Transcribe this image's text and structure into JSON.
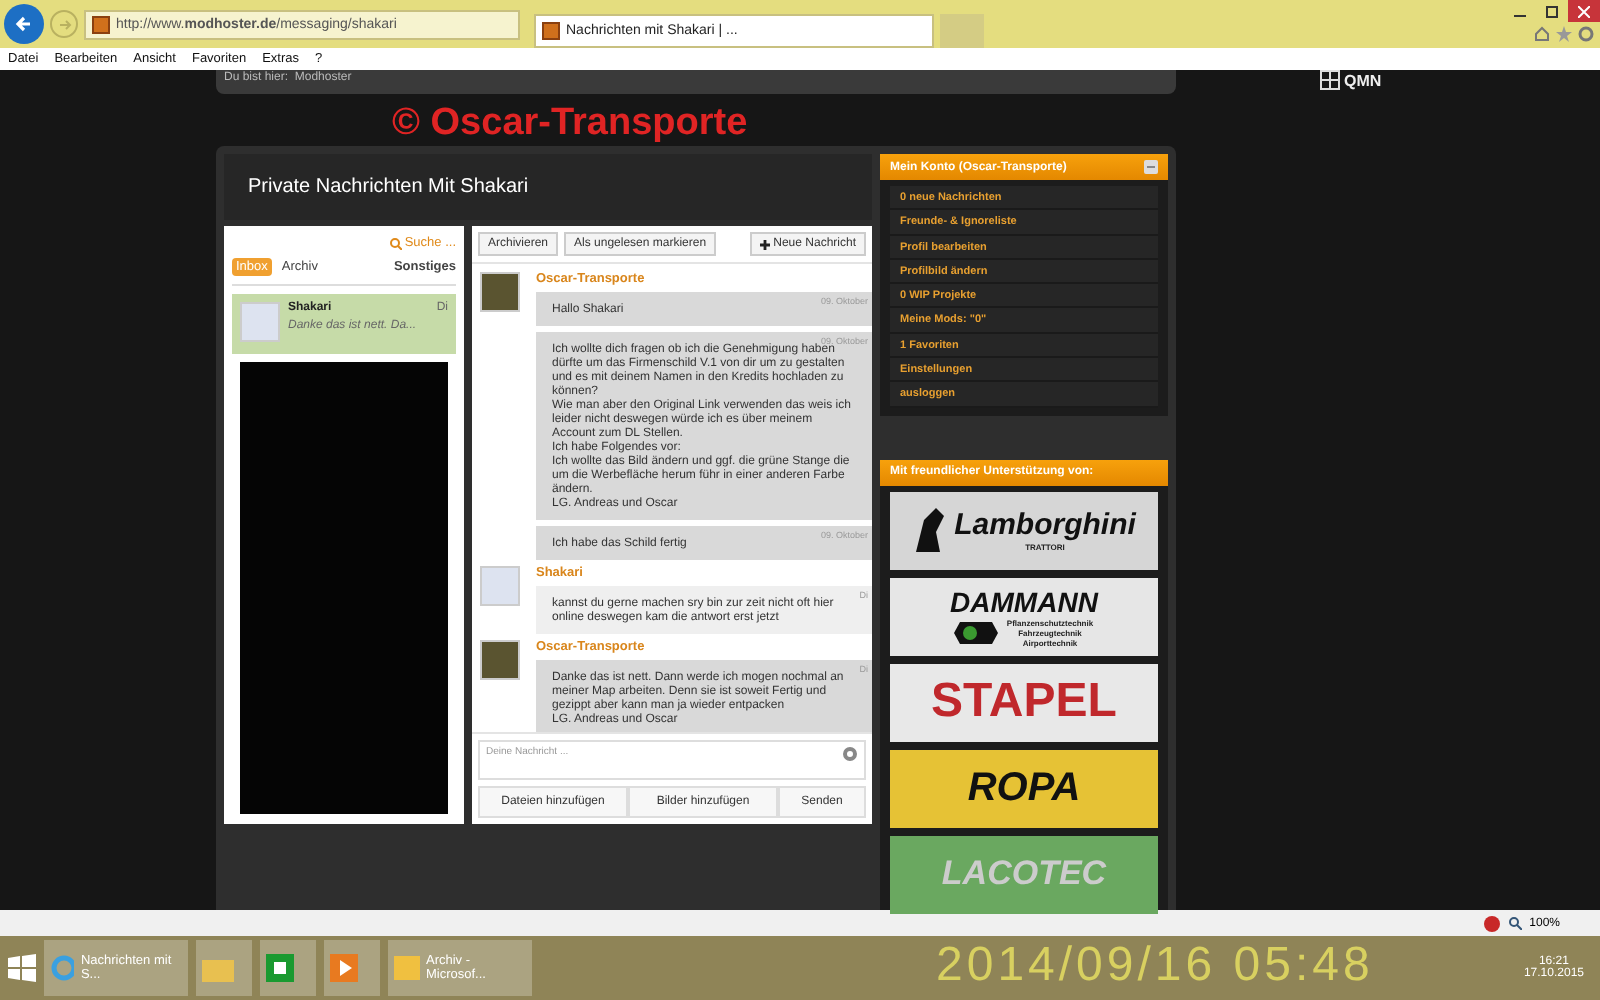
{
  "browser": {
    "address": "http://www.**modhoster.de**/messaging/shakari",
    "tab": "Nachrichten mit Shakari | ...",
    "menu": [
      "Datei",
      "Bearbeiten",
      "Ansicht",
      "Favoriten",
      "Extras",
      "?"
    ]
  },
  "breadcrumb": {
    "label": "Du bist hier:",
    "value": "Modhoster"
  },
  "site_logo": "QMN",
  "overlay_text": "© Oscar-Transporte",
  "page_title": "Private Nachrichten Mit Shakari",
  "inbox": {
    "search": "Suche ...",
    "tabs": [
      {
        "label": "Inbox",
        "selected": true
      },
      {
        "label": "Archiv",
        "selected": false
      }
    ],
    "other": "Sonstiges",
    "conversations": [
      {
        "name": "Shakari",
        "preview": "Danke das ist nett. Da...",
        "day": "Di",
        "selected": true
      }
    ]
  },
  "thread": {
    "actions": [
      "Archivieren",
      "Als ungelesen markieren"
    ],
    "new_button": "Neue Nachricht",
    "messages": [
      {
        "author": "Oscar-Transporte",
        "kind": "own",
        "bubbles": [
          {
            "date": "09. Oktober",
            "text": "Hallo Shakari"
          },
          {
            "date": "09. Oktober",
            "text": "Ich wollte dich fragen ob ich die Genehmigung haben dürfte um das Firmenschild V.1 von dir um zu gestalten und es mit deinem Namen in den Kredits hochladen zu können?\nWie man aber den Original Link verwenden das weis ich leider nicht deswegen würde ich es über meinem Account zum DL Stellen.\nIch habe Folgendes vor:\nIch wollte das Bild ändern und ggf. die grüne Stange die um die Werbefläche herum führ in einer anderen Farbe ändern.\nLG. Andreas und Oscar"
          },
          {
            "date": "09. Oktober",
            "text": "Ich habe das Schild fertig"
          }
        ]
      },
      {
        "author": "Shakari",
        "kind": "other",
        "bubbles": [
          {
            "date": "Di",
            "text": "kannst du gerne machen sry bin zur zeit nicht oft hier online deswegen kam die antwort erst jetzt"
          }
        ]
      },
      {
        "author": "Oscar-Transporte",
        "kind": "own",
        "bubbles": [
          {
            "date": "Di",
            "text": "Danke das ist nett. Dann werde ich mogen nochmal an meiner Map arbeiten. Denn sie ist soweit Fertig und gezippt aber kann man ja wieder entpacken\nLG. Andreas und Oscar"
          }
        ]
      }
    ],
    "composer": {
      "placeholder": "Deine Nachricht ...",
      "buttons": [
        "Dateien hinzufügen",
        "Bilder hinzufügen",
        "Senden"
      ]
    }
  },
  "account": {
    "title": "Mein Konto (Oscar-Transporte)",
    "items": [
      "0 neue Nachrichten",
      "Freunde- & Ignoreliste",
      "Profil bearbeiten",
      "Profilbild ändern",
      "0 WIP Projekte",
      "Meine Mods: \"0\"",
      "1 Favoriten",
      "Einstellungen",
      "ausloggen"
    ]
  },
  "sponsors": {
    "title": "Mit freundlicher Unterstützung von:",
    "logos": [
      {
        "kind": "lamborghini",
        "name": "Lamborghini",
        "sub": "TRATTORI"
      },
      {
        "kind": "dammann",
        "name": "DAMMANN",
        "lines": [
          "Pflanzenschutztechnik",
          "Fahrzeugtechnik",
          "Airporttechnik"
        ]
      },
      {
        "kind": "stapel",
        "name": "STAPEL"
      },
      {
        "kind": "ropa",
        "name": "ROPA"
      },
      {
        "kind": "lacotec",
        "name": "LACOTEC"
      }
    ]
  },
  "status_bar": {
    "zoom": "100%"
  },
  "taskbar": {
    "items": [
      {
        "kind": "ie",
        "label": "Nachrichten mit S..."
      },
      {
        "kind": "folder"
      },
      {
        "kind": "store"
      },
      {
        "kind": "media"
      },
      {
        "kind": "outlook",
        "label": "Archiv - Microsof..."
      }
    ],
    "time": "16:21",
    "date": "17.10.2015",
    "wallpaper_text": "2014/09/16 05:48"
  }
}
